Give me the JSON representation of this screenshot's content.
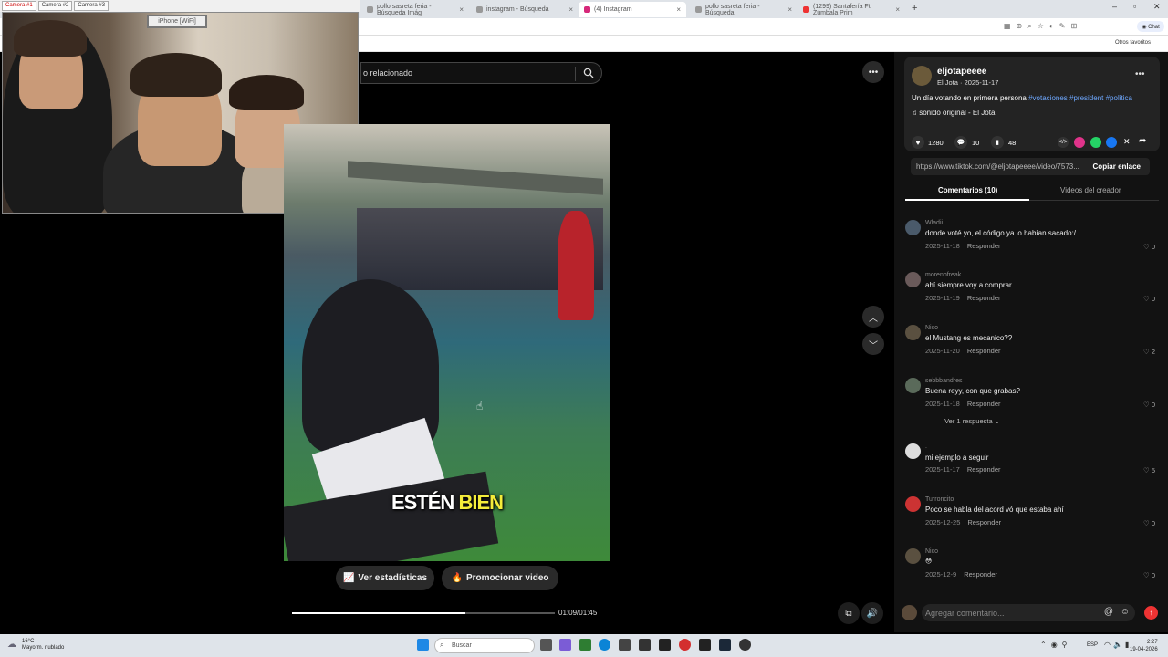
{
  "browser": {
    "tabs": [
      {
        "title": "pollo sasreta feria - Búsqueda Imág"
      },
      {
        "title": "instagram - Búsqueda"
      },
      {
        "title": "(4) Instagram"
      },
      {
        "title": "pollo sasreta feria - Búsqueda"
      },
      {
        "title": "(1299) Santafería Ft. Zúmbala Prim"
      }
    ],
    "new_tab": "+",
    "bookmarks_label": "Otros favoritos"
  },
  "camera": {
    "tabs": [
      "Camera #1",
      "Camera #2",
      "Camera #3"
    ],
    "device_label": "iPhone [WiFi]"
  },
  "search": {
    "text": "o relacionado"
  },
  "video": {
    "caption_word1": "ESTÉN",
    "caption_word2": "BIEN",
    "stats_button": "Ver estadísticas",
    "promote_button": "Promocionar video",
    "time": "01:09/01:45",
    "progress": 0.66
  },
  "post": {
    "username": "eljotapeeee",
    "subtitle": "El Jota · 2025-11-17",
    "description": "Un día votando en primera persona",
    "hashtags": "#votaciones #president #politica",
    "sound": "sonido original - El Jota",
    "likes": "1280",
    "comments": "10",
    "saves": "48",
    "link": "https://www.tiktok.com/@eljotapeeee/video/7573...",
    "copy_link": "Copiar enlace"
  },
  "tabs": {
    "comments": "Comentarios (10)",
    "creator_videos": "Videos del creador"
  },
  "comments": [
    {
      "user": "Wladii",
      "text": "donde voté yo, el código ya lo habían sacado:/",
      "date": "2025-11-18",
      "reply": "Responder",
      "likes": "0"
    },
    {
      "user": "morenofreak",
      "text": "ahí siempre voy a comprar",
      "date": "2025-11-19",
      "reply": "Responder",
      "likes": "0"
    },
    {
      "user": "Nico",
      "text": "el Mustang es mecanico??",
      "date": "2025-11-20",
      "reply": "Responder",
      "likes": "2"
    },
    {
      "user": "sebbbandres",
      "text": "Buena reyy, con que grabas?",
      "date": "2025-11-18",
      "reply": "Responder",
      "likes": "0"
    },
    {
      "user": ".",
      "text": "mi ejemplo a seguir",
      "date": "2025-11-17",
      "reply": "Responder",
      "likes": "5"
    },
    {
      "user": "Turroncito",
      "text": "Poco se habla del acord vó que estaba ahí",
      "date": "2025-12-25",
      "reply": "Responder",
      "likes": "0"
    },
    {
      "user": "Nico",
      "text": "😳",
      "date": "2025-12-9",
      "reply": "Responder",
      "likes": "0"
    }
  ],
  "replies_link": "Ver 1 respuesta",
  "comment_placeholder": "Agregar comentario...",
  "taskbar": {
    "temp": "16°C",
    "weather": "Mayorm. nublado",
    "search": "Buscar",
    "lang": "ESP",
    "time": "2:27",
    "date": "19-04-2026"
  },
  "colors": {
    "hashtag": "#6ea8ff",
    "caption_highlight": "#f4ec3a",
    "send": "#ee3333"
  }
}
